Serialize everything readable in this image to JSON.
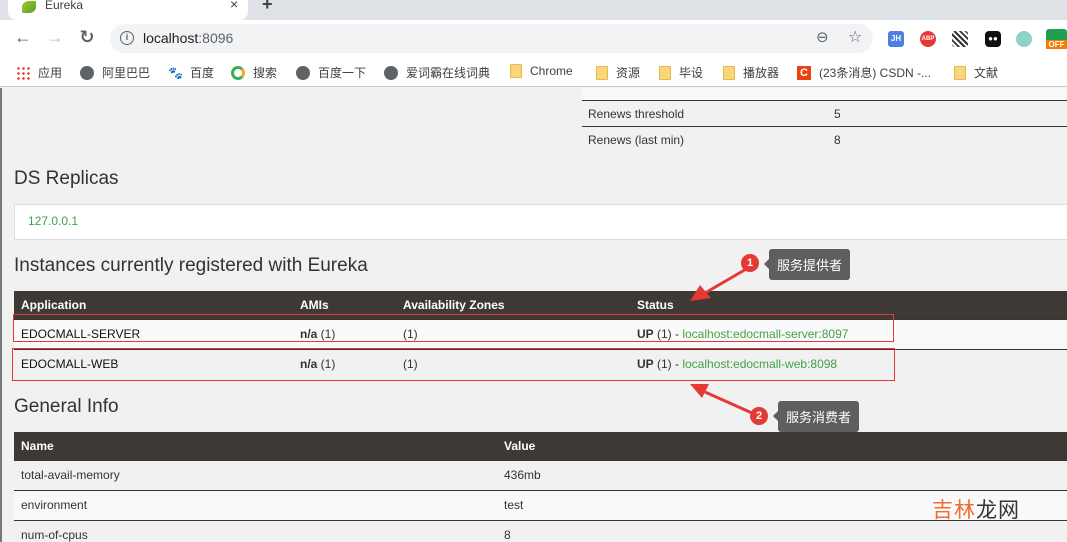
{
  "browser": {
    "tab_title": "Eureka",
    "tab_close": "×",
    "new_tab": "+",
    "back": "←",
    "forward": "→",
    "reload": "↻",
    "info": "i",
    "url_host": "localhost",
    "url_port": ":8096",
    "zoom": "⊖",
    "star": "☆",
    "extensions": [
      {
        "name": "jh",
        "label": "JH"
      },
      {
        "name": "abp",
        "label": "ABP"
      },
      {
        "name": "qr",
        "label": ""
      },
      {
        "name": "tampermonkey",
        "label": "●●"
      },
      {
        "name": "cat",
        "label": ""
      },
      {
        "name": "off",
        "label": "i",
        "sub": "OFF"
      }
    ],
    "bookmarks": [
      {
        "label": "应用",
        "icon": "apps-icon"
      },
      {
        "label": "阿里巴巴",
        "icon": "globe-icon"
      },
      {
        "label": "百度",
        "icon": "baidu-icon"
      },
      {
        "label": "搜索",
        "icon": "search-engine-icon"
      },
      {
        "label": "百度一下",
        "icon": "globe-icon"
      },
      {
        "label": "爱词霸在线词典",
        "icon": "globe-icon"
      },
      {
        "label": "Chrome",
        "icon": "folder-icon"
      },
      {
        "label": "资源",
        "icon": "folder-icon"
      },
      {
        "label": "毕设",
        "icon": "folder-icon"
      },
      {
        "label": "播放器",
        "icon": "folder-icon"
      },
      {
        "label": "(23条消息) CSDN -...",
        "icon": "csdn-icon"
      },
      {
        "label": "文献",
        "icon": "folder-icon"
      }
    ]
  },
  "renews": {
    "rows": [
      {
        "name": "Renews threshold",
        "value": "5"
      },
      {
        "name": "Renews (last min)",
        "value": "8"
      }
    ]
  },
  "replicas": {
    "title": "DS Replicas",
    "items": [
      "127.0.0.1"
    ]
  },
  "instances": {
    "title": "Instances currently registered with Eureka",
    "headers": [
      "Application",
      "AMIs",
      "Availability Zones",
      "Status"
    ],
    "rows": [
      {
        "application": "EDOCMALL-SERVER",
        "amis_bold": "n/a",
        "amis_count": " (1)",
        "zones": "(1)",
        "status_bold": "UP",
        "status_rest": " (1) - ",
        "link": "localhost:edocmall-server:8097"
      },
      {
        "application": "EDOCMALL-WEB",
        "amis_bold": "n/a",
        "amis_count": " (1)",
        "zones": "(1)",
        "status_bold": "UP",
        "status_rest": " (1) - ",
        "link": "localhost:edocmall-web:8098"
      }
    ]
  },
  "general": {
    "title": "General Info",
    "headers": [
      "Name",
      "Value"
    ],
    "rows": [
      {
        "name": "total-avail-memory",
        "value": "436mb"
      },
      {
        "name": "environment",
        "value": "test"
      },
      {
        "name": "num-of-cpus",
        "value": "8"
      }
    ]
  },
  "annotations": [
    {
      "number": "1",
      "text": "服务提供者"
    },
    {
      "number": "2",
      "text": "服务消费者"
    }
  ],
  "watermark": {
    "part1": "吉林",
    "part2": "龙网"
  },
  "colors": {
    "header_bg": "#3e3935",
    "link_green": "#43a047",
    "annotation_red": "#e53935"
  }
}
